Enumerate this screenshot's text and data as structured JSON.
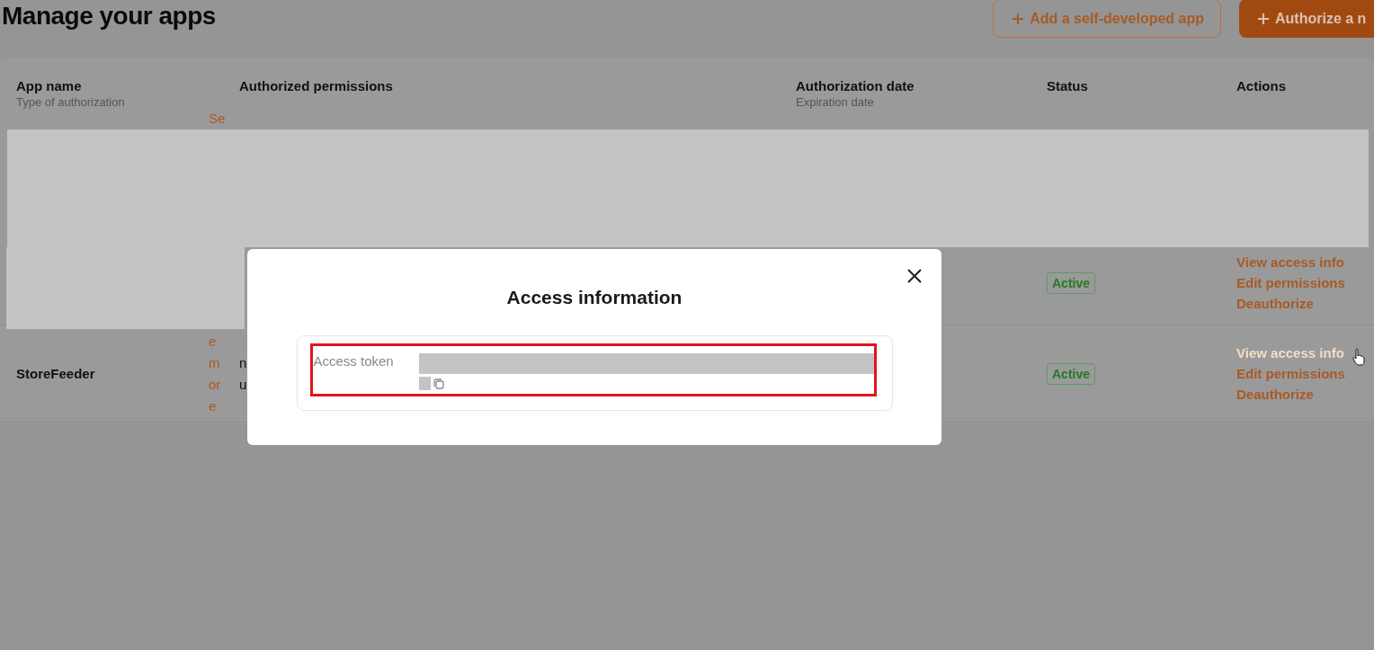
{
  "page": {
    "title": "Manage your apps",
    "buttons": [
      {
        "label": "Add a self-developed app",
        "kind": "outline"
      },
      {
        "label": "Authorize a n",
        "kind": "filled"
      }
    ]
  },
  "table": {
    "columns": [
      {
        "title": "App name",
        "subtitle": "Type of authorization"
      },
      {
        "title": "Authorized permissions"
      },
      {
        "title": "Authorization date",
        "subtitle": "Expiration date"
      },
      {
        "title": "Status"
      },
      {
        "title": "Actions"
      }
    ],
    "rows": [
      {
        "app_name": "",
        "link_fragments": [
          "Se"
        ],
        "permission_fragments": [],
        "status": "Active",
        "actions": [
          {
            "label": "View access info",
            "hovered": false
          },
          {
            "label": "Edit permissions",
            "hovered": false
          },
          {
            "label": "Deauthorize",
            "hovered": false
          }
        ]
      },
      {
        "app_name": "StoreFeeder",
        "link_fragments": [
          "e",
          "m",
          "or",
          "e"
        ],
        "permission_fragments": [
          {
            "text": "n"
          },
          {
            "text": "u"
          }
        ],
        "status": "Active",
        "actions": [
          {
            "label": "View access info",
            "hovered": true
          },
          {
            "label": "Edit permissions",
            "hovered": false
          },
          {
            "label": "Deauthorize",
            "hovered": false
          }
        ]
      }
    ]
  },
  "dialog": {
    "title": "Access information",
    "fields": [
      {
        "label": "Access token",
        "highlighted": true
      }
    ]
  }
}
